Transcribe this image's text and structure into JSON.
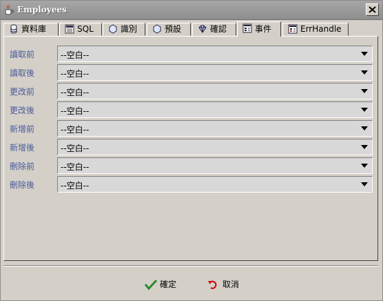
{
  "window": {
    "title": "Employees"
  },
  "tabs": [
    {
      "label": "資料庫",
      "icon": "database-icon",
      "active": false
    },
    {
      "label": "SQL",
      "icon": "sql-icon",
      "active": false
    },
    {
      "label": "識別",
      "icon": "identity-hexagon-icon",
      "active": false
    },
    {
      "label": "預設",
      "icon": "default-hexagon-icon",
      "active": false
    },
    {
      "label": "確認",
      "icon": "validate-gem-icon",
      "active": false
    },
    {
      "label": "事件",
      "icon": "event-form-icon",
      "active": true
    },
    {
      "label": "ErrHandle",
      "icon": "error-handle-icon",
      "active": false
    }
  ],
  "events": [
    {
      "label": "讀取前",
      "value": "--空白--"
    },
    {
      "label": "讀取後",
      "value": "--空白--"
    },
    {
      "label": "更改前",
      "value": "--空白--"
    },
    {
      "label": "更改後",
      "value": "--空白--"
    },
    {
      "label": "新增前",
      "value": "--空白--"
    },
    {
      "label": "新增後",
      "value": "--空白--"
    },
    {
      "label": "刪除前",
      "value": "--空白--"
    },
    {
      "label": "刪除後",
      "value": "--空白--"
    }
  ],
  "footer": {
    "ok_label": "確定",
    "cancel_label": "取消"
  },
  "colors": {
    "label_text": "#4a5a9a",
    "ok_check": "#2a8a2a",
    "cancel_arrow": "#d00000"
  }
}
